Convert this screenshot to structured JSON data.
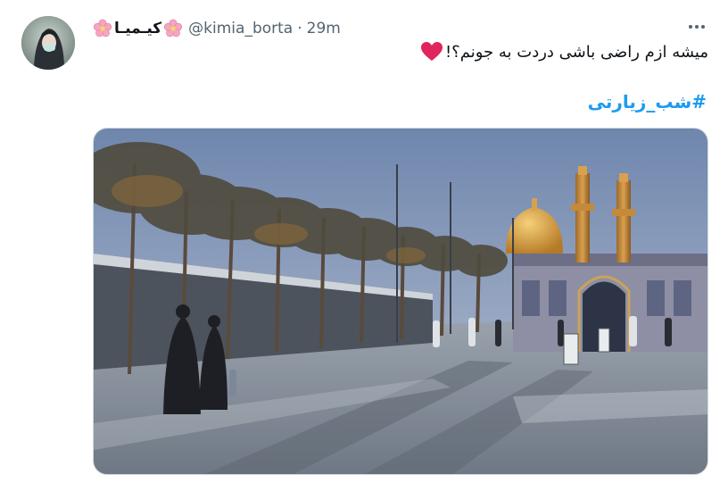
{
  "tweet": {
    "display_name": "کیـمیـا",
    "handle": "@kimia_borta",
    "separator": "·",
    "time": "29m",
    "text": "میشه ازم راضی باشی دردت به جونم؟!",
    "hashtag": "#شب_زیارتی",
    "flower_color": "#f4a6c0",
    "heart_color": "#e0245e",
    "link_color": "#1d9bf0"
  },
  "icons": {
    "more": "more-horizontal-icon",
    "flower": "cherry-blossom-icon",
    "heart": "red-heart-icon"
  }
}
